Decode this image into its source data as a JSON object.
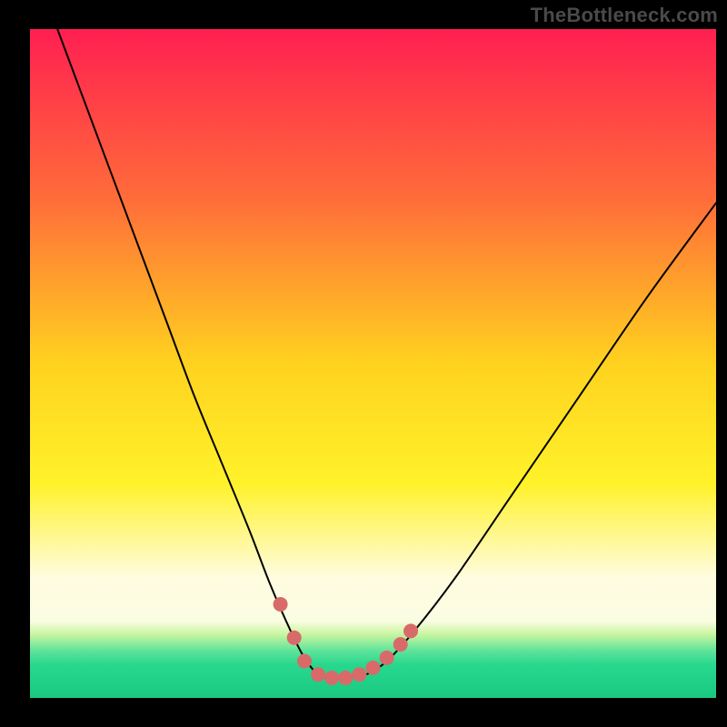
{
  "watermark": "TheBottleneck.com",
  "chart_data": {
    "type": "line",
    "title": "",
    "xlabel": "",
    "ylabel": "",
    "xlim": [
      0,
      100
    ],
    "ylim": [
      0,
      100
    ],
    "background": {
      "type": "vertical_gradient",
      "stops": [
        {
          "offset": 0.0,
          "color": "#ff1f51"
        },
        {
          "offset": 0.25,
          "color": "#ff6b3a"
        },
        {
          "offset": 0.5,
          "color": "#ffd21f"
        },
        {
          "offset": 0.68,
          "color": "#fff22a"
        },
        {
          "offset": 0.82,
          "color": "#fffce0"
        },
        {
          "offset": 0.885,
          "color": "#fafde2"
        },
        {
          "offset": 0.905,
          "color": "#c8f5a0"
        },
        {
          "offset": 0.93,
          "color": "#5de39a"
        },
        {
          "offset": 0.95,
          "color": "#28d88e"
        },
        {
          "offset": 1.0,
          "color": "#18c97f"
        }
      ]
    },
    "series": [
      {
        "name": "bottleneck-curve",
        "color": "#000000",
        "stroke_width": 2,
        "x": [
          4,
          8,
          12,
          16,
          20,
          24,
          28,
          32,
          35,
          38,
          40,
          42,
          44,
          46,
          49,
          52,
          56,
          62,
          70,
          80,
          90,
          100
        ],
        "y": [
          100,
          89,
          78,
          67,
          56,
          45,
          35,
          25,
          17,
          10,
          6,
          3.5,
          3,
          3,
          3.5,
          5.5,
          10,
          18,
          30,
          45,
          60,
          74
        ]
      }
    ],
    "markers": {
      "name": "highlight-dots",
      "color": "#d96a6a",
      "radius": 8,
      "points": [
        {
          "x": 36.5,
          "y": 14.0
        },
        {
          "x": 38.5,
          "y": 9.0
        },
        {
          "x": 40.0,
          "y": 5.5
        },
        {
          "x": 42.0,
          "y": 3.5
        },
        {
          "x": 44.0,
          "y": 3.0
        },
        {
          "x": 46.0,
          "y": 3.0
        },
        {
          "x": 48.0,
          "y": 3.5
        },
        {
          "x": 50.0,
          "y": 4.5
        },
        {
          "x": 52.0,
          "y": 6.0
        },
        {
          "x": 54.0,
          "y": 8.0
        },
        {
          "x": 55.5,
          "y": 10.0
        }
      ]
    }
  }
}
